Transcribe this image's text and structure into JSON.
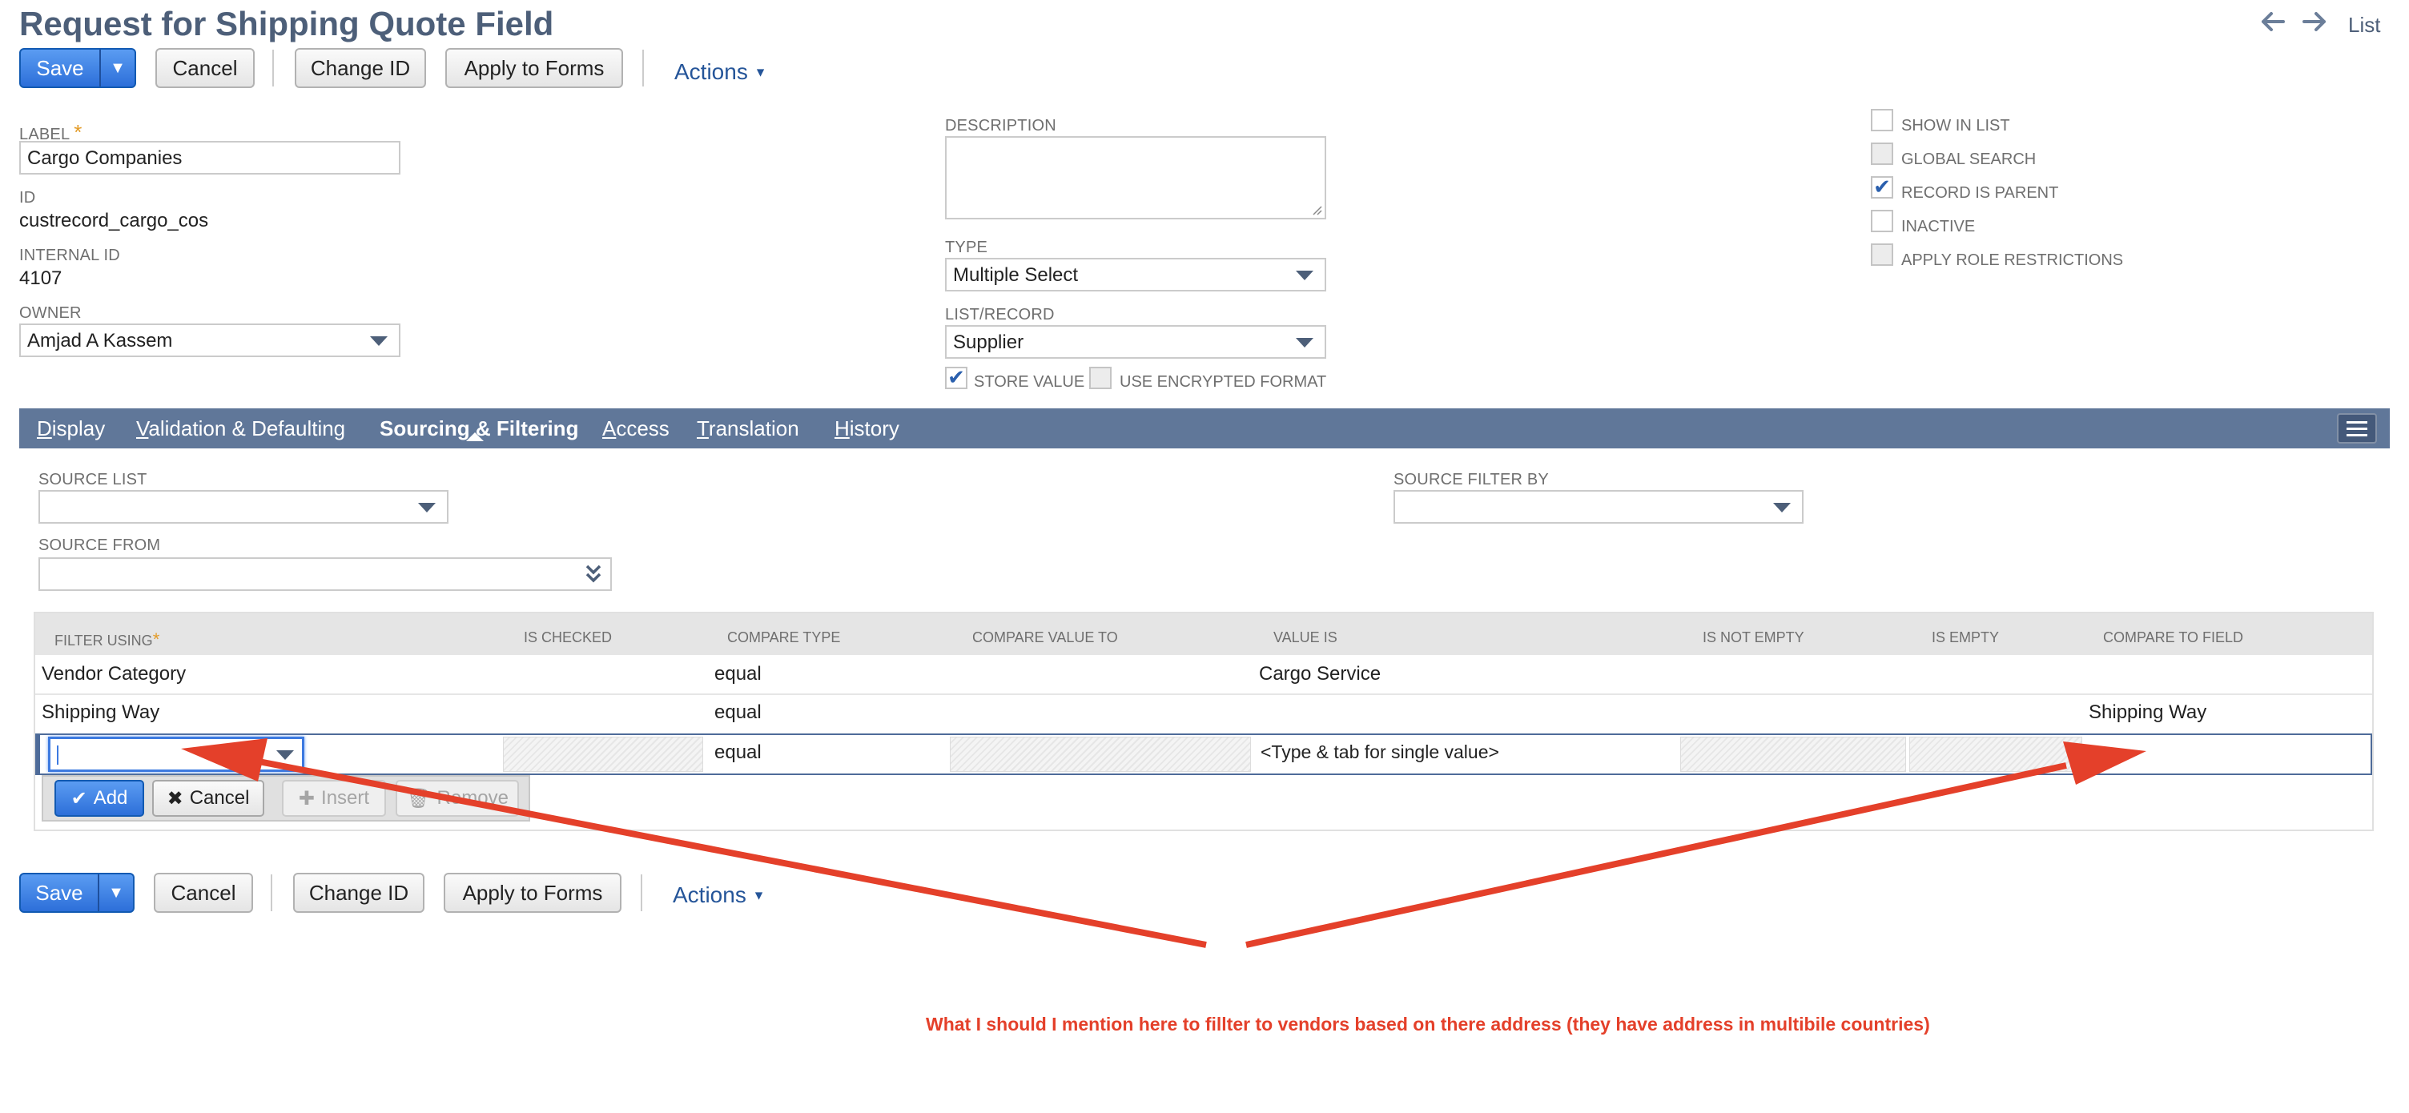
{
  "header": {
    "title": "Request for Shipping Quote Field",
    "list_label": "List",
    "back_icon": "arrow-left-icon",
    "forward_icon": "arrow-right-icon"
  },
  "toolbar": {
    "save_label": "Save",
    "cancel_label": "Cancel",
    "change_id_label": "Change ID",
    "apply_to_forms_label": "Apply to Forms",
    "actions_label": "Actions"
  },
  "fields": {
    "label_label": "LABEL",
    "required_mark": "*",
    "label_value": "Cargo Companies",
    "id_label": "ID",
    "id_value": "custrecord_cargo_cos",
    "internal_id_label": "INTERNAL ID",
    "internal_id_value": "4107",
    "owner_label": "OWNER",
    "owner_value": "Amjad A Kassem",
    "description_label": "DESCRIPTION",
    "type_label": "TYPE",
    "type_value": "Multiple Select",
    "list_record_label": "LIST/RECORD",
    "list_record_value": "Supplier",
    "store_value_label": "STORE VALUE",
    "use_encrypted_label": "USE ENCRYPTED FORMAT"
  },
  "checkboxes": [
    {
      "label": "SHOW IN LIST",
      "checked": false,
      "disabled": false
    },
    {
      "label": "GLOBAL SEARCH",
      "checked": false,
      "disabled": true
    },
    {
      "label": "RECORD IS PARENT",
      "checked": true,
      "disabled": false
    },
    {
      "label": "INACTIVE",
      "checked": false,
      "disabled": false
    },
    {
      "label": "APPLY ROLE RESTRICTIONS",
      "checked": false,
      "disabled": true
    }
  ],
  "tabs": [
    {
      "accel": "D",
      "rest": "isplay",
      "active": false
    },
    {
      "accel": "V",
      "rest": "alidation & Defaulting",
      "active": false
    },
    {
      "accel": "",
      "rest": "Sourcing & Filtering",
      "active": true
    },
    {
      "accel": "A",
      "rest": "ccess",
      "active": false
    },
    {
      "accel": "T",
      "rest": "ranslation",
      "active": false
    },
    {
      "accel": "H",
      "rest": "istory",
      "active": false
    }
  ],
  "sourcing": {
    "source_list_label": "SOURCE LIST",
    "source_filter_by_label": "SOURCE FILTER BY",
    "source_from_label": "SOURCE FROM"
  },
  "grid": {
    "columns": [
      "FILTER USING",
      "IS CHECKED",
      "COMPARE TYPE",
      "COMPARE VALUE TO",
      "VALUE IS",
      "IS NOT EMPTY",
      "IS EMPTY",
      "COMPARE TO FIELD"
    ],
    "rows": [
      {
        "filter_using": "Vendor Category",
        "compare_type": "equal",
        "value_is": "Cargo Service",
        "compare_to_field": ""
      },
      {
        "filter_using": "Shipping Way",
        "compare_type": "equal",
        "value_is": "",
        "compare_to_field": "Shipping Way"
      }
    ],
    "edit_row": {
      "compare_type": "equal",
      "value_is_placeholder": "<Type & tab for single value>"
    },
    "buttons": {
      "add": "Add",
      "cancel": "Cancel",
      "insert": "Insert",
      "remove": "Remove"
    }
  },
  "annotation": {
    "text": "What I should I mention here to fillter to vendors based on there address (they have address in multibile countries)",
    "color": "#e4402a"
  },
  "colors": {
    "title": "#4d5f79",
    "tabbar": "#607799",
    "primary": "#2d6fd9",
    "link": "#255599"
  }
}
